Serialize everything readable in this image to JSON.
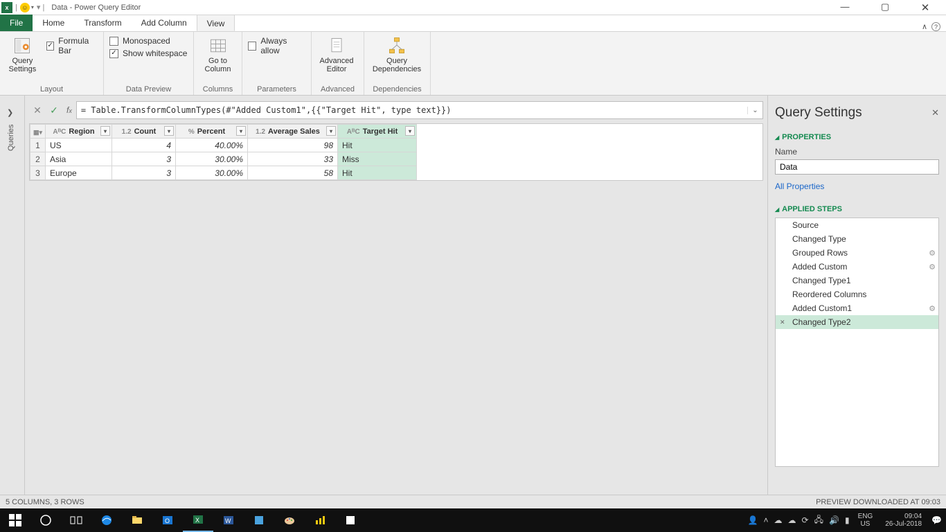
{
  "window": {
    "title_prefix": "Data - Power Query Editor",
    "min": "—",
    "max": "▢",
    "close": "✕"
  },
  "tabs": {
    "file": "File",
    "items": [
      "Home",
      "Transform",
      "Add Column",
      "View"
    ],
    "active": "View"
  },
  "ribbon": {
    "layout": {
      "label": "Layout",
      "query_settings": "Query\nSettings",
      "formula_bar": "Formula Bar"
    },
    "data_preview": {
      "label": "Data Preview",
      "monospaced": "Monospaced",
      "whitespace": "Show whitespace"
    },
    "columns": {
      "label": "Columns",
      "goto": "Go to\nColumn"
    },
    "parameters": {
      "label": "Parameters",
      "always": "Always allow"
    },
    "advanced": {
      "label": "Advanced",
      "editor": "Advanced\nEditor"
    },
    "dependencies": {
      "label": "Dependencies",
      "btn": "Query\nDependencies"
    }
  },
  "formula": "= Table.TransformColumnTypes(#\"Added Custom1\",{{\"Target Hit\", type text}})",
  "leftrail": {
    "label": "Queries"
  },
  "columns": [
    {
      "type": "AᴮC",
      "name": "Region",
      "cls": "col-region"
    },
    {
      "type": "1.2",
      "name": "Count",
      "cls": "col-count"
    },
    {
      "type": "%",
      "name": "Percent",
      "cls": "col-percent"
    },
    {
      "type": "1.2",
      "name": "Average Sales",
      "cls": "col-avg"
    },
    {
      "type": "AᴮC",
      "name": "Target Hit",
      "cls": "col-hit",
      "selected": true
    }
  ],
  "rows": [
    {
      "n": "1",
      "region": "US",
      "count": "4",
      "percent": "40.00%",
      "avg": "98",
      "hit": "Hit"
    },
    {
      "n": "2",
      "region": "Asia",
      "count": "3",
      "percent": "30.00%",
      "avg": "33",
      "hit": "Miss"
    },
    {
      "n": "3",
      "region": "Europe",
      "count": "3",
      "percent": "30.00%",
      "avg": "58",
      "hit": "Hit"
    }
  ],
  "settings_panel": {
    "title": "Query Settings",
    "properties": "PROPERTIES",
    "name_label": "Name",
    "name_value": "Data",
    "all_props": "All Properties",
    "applied_steps": "APPLIED STEPS",
    "steps": [
      {
        "t": "Source"
      },
      {
        "t": "Changed Type"
      },
      {
        "t": "Grouped Rows",
        "gear": true
      },
      {
        "t": "Added Custom",
        "gear": true
      },
      {
        "t": "Changed Type1"
      },
      {
        "t": "Reordered Columns"
      },
      {
        "t": "Added Custom1",
        "gear": true
      },
      {
        "t": "Changed Type2",
        "selected": true
      }
    ]
  },
  "status": {
    "left": "5 COLUMNS, 3 ROWS",
    "right": "PREVIEW DOWNLOADED AT 09:03"
  },
  "taskbar": {
    "lang1": "ENG",
    "lang2": "US",
    "time": "09:04",
    "date": "26-Jul-2018"
  }
}
